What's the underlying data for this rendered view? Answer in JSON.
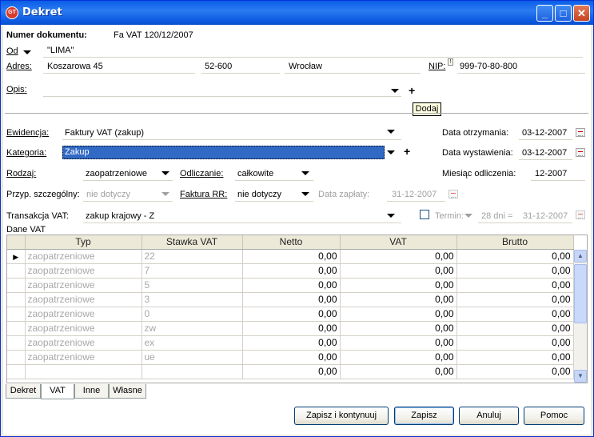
{
  "window": {
    "title": "Dekret",
    "icon_text": "GT"
  },
  "document": {
    "number_label": "Numer dokumentu:",
    "number_value": "Fa VAT 120/12/2007",
    "from_label": "Od",
    "from_value": "\"LIMA\"",
    "address_label": "Adres:",
    "street": "Koszarowa 45",
    "postcode": "52-600",
    "city": "Wrocław",
    "nip_label": "NIP:",
    "nip_value": "999-70-80-800",
    "description_label": "Opis:",
    "tooltip": "Dodaj"
  },
  "fields": {
    "ewidencja_label": "Ewidencja:",
    "ewidencja_value": "Faktury VAT (zakup)",
    "kategoria_label": "Kategoria:",
    "kategoria_value": "Zakup",
    "rodzaj_label": "Rodzaj:",
    "rodzaj_value": "zaopatrzeniowe",
    "odliczanie_label": "Odliczanie:",
    "odliczanie_value": "całkowite",
    "przyp_label": "Przyp. szczególny:",
    "przyp_value": "nie dotyczy",
    "faktura_rr_label": "Faktura RR:",
    "faktura_rr_value": "nie dotyczy",
    "data_zaplaty_label": "Data zapłaty:",
    "data_zaplaty_value": "31-12-2007",
    "transakcja_label": "Transakcja VAT:",
    "transakcja_value": "zakup krajowy - Z",
    "termin_label": "Termin:",
    "termin_days": "28 dni =",
    "termin_date": "31-12-2007",
    "data_otrzymania_label": "Data otrzymania:",
    "data_otrzymania_value": "03-12-2007",
    "data_wystawienia_label": "Data wystawienia:",
    "data_wystawienia_value": "03-12-2007",
    "miesiac_label": "Miesiąc odliczenia:",
    "miesiac_value": "12-2007",
    "dane_vat_label": "Dane VAT"
  },
  "vat_table": {
    "columns": [
      "Typ",
      "Stawka VAT",
      "Netto",
      "VAT",
      "Brutto"
    ],
    "rows": [
      {
        "typ": "zaopatrzeniowe",
        "stawka": "22",
        "netto": "0,00",
        "vat": "0,00",
        "brutto": "0,00"
      },
      {
        "typ": "zaopatrzeniowe",
        "stawka": "7",
        "netto": "0,00",
        "vat": "0,00",
        "brutto": "0,00"
      },
      {
        "typ": "zaopatrzeniowe",
        "stawka": "5",
        "netto": "0,00",
        "vat": "0,00",
        "brutto": "0,00"
      },
      {
        "typ": "zaopatrzeniowe",
        "stawka": "3",
        "netto": "0,00",
        "vat": "0,00",
        "brutto": "0,00"
      },
      {
        "typ": "zaopatrzeniowe",
        "stawka": "0",
        "netto": "0,00",
        "vat": "0,00",
        "brutto": "0,00"
      },
      {
        "typ": "zaopatrzeniowe",
        "stawka": "zw",
        "netto": "0,00",
        "vat": "0,00",
        "brutto": "0,00"
      },
      {
        "typ": "zaopatrzeniowe",
        "stawka": "ex",
        "netto": "0,00",
        "vat": "0,00",
        "brutto": "0,00"
      },
      {
        "typ": "zaopatrzeniowe",
        "stawka": "ue",
        "netto": "0,00",
        "vat": "0,00",
        "brutto": "0,00"
      }
    ],
    "totals": {
      "netto": "0,00",
      "vat": "0,00",
      "brutto": "0,00"
    }
  },
  "tabs": [
    "Dekret",
    "VAT",
    "Inne",
    "Własne"
  ],
  "buttons": {
    "save_continue": "Zapisz i kontynuuj",
    "save": "Zapisz",
    "cancel": "Anuluj",
    "help": "Pomoc"
  }
}
